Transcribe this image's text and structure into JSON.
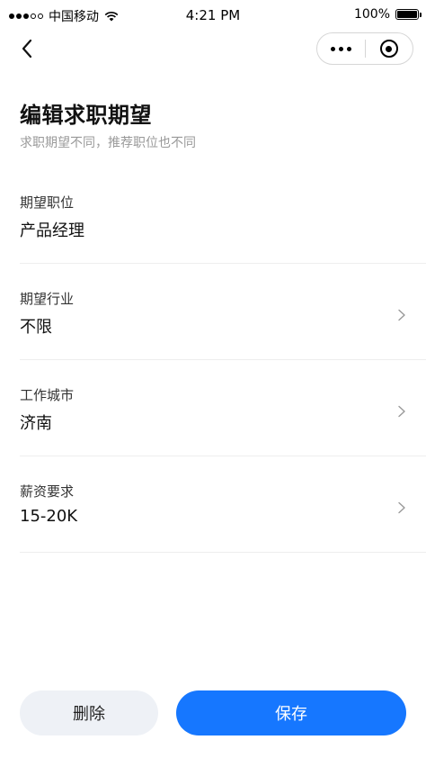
{
  "status_bar": {
    "carrier": "中国移动",
    "time": "4:21 PM",
    "battery": "100%",
    "battery_level": 1.0
  },
  "nav": {
    "back_icon": "chevron-left-icon",
    "more_icon": "more-dots-icon",
    "close_icon": "target-close-icon"
  },
  "header": {
    "title": "编辑求职期望",
    "subtitle": "求职期望不同，推荐职位也不同"
  },
  "form": {
    "rows": [
      {
        "label": "期望职位",
        "value": "产品经理",
        "has_chevron": false
      },
      {
        "label": "期望行业",
        "value": "不限",
        "has_chevron": true
      },
      {
        "label": "工作城市",
        "value": "济南",
        "has_chevron": true
      },
      {
        "label": "薪资要求",
        "value": "15-20K",
        "has_chevron": true
      }
    ]
  },
  "actions": {
    "delete_label": "删除",
    "save_label": "保存"
  },
  "colors": {
    "primary": "#1677ff",
    "secondary_button": "#eef1f6",
    "subtitle_text": "#999999",
    "divider": "#eeeeee"
  }
}
